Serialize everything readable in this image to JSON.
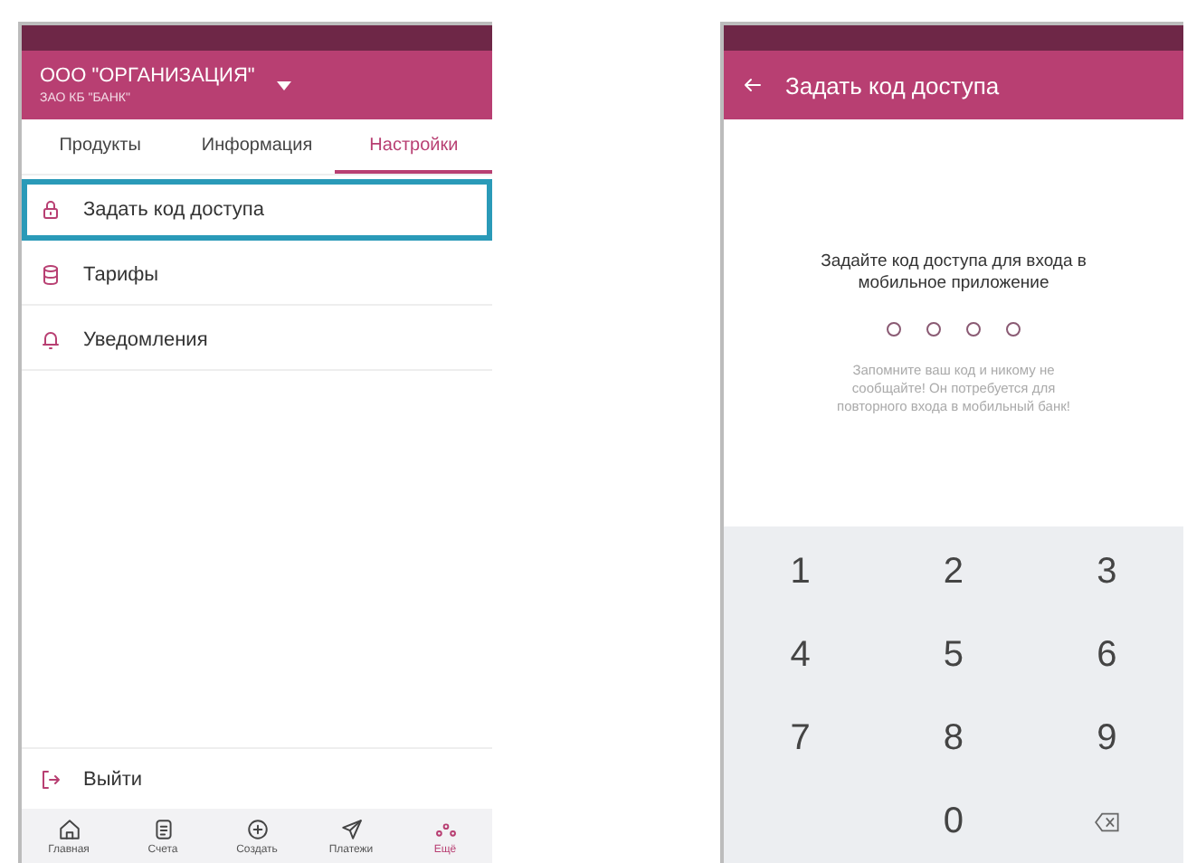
{
  "left_screen": {
    "header": {
      "organization": "ООО \"ОРГАНИЗАЦИЯ\"",
      "bank": "ЗАО КБ \"БАНК\""
    },
    "tabs": [
      {
        "label": "Продукты",
        "selected": false
      },
      {
        "label": "Информация",
        "selected": false
      },
      {
        "label": "Настройки",
        "selected": true
      }
    ],
    "menu": [
      {
        "label": "Задать код доступа",
        "kind": "lock",
        "highlighted": true
      },
      {
        "label": "Тарифы",
        "kind": "database",
        "highlighted": false
      },
      {
        "label": "Уведомления",
        "kind": "bell",
        "highlighted": false
      }
    ],
    "logout": {
      "label": "Выйти"
    },
    "bottom_nav": [
      {
        "label": "Главная",
        "kind": "home",
        "selected": false
      },
      {
        "label": "Счета",
        "kind": "document",
        "selected": false
      },
      {
        "label": "Создать",
        "kind": "plus",
        "selected": false
      },
      {
        "label": "Платежи",
        "kind": "send",
        "selected": false
      },
      {
        "label": "Ещё",
        "kind": "more",
        "selected": true
      }
    ]
  },
  "right_screen": {
    "title": "Задать код доступа",
    "prompt": "Задайте код доступа для входа в мобильное приложение",
    "pin_dots": [
      {
        "filled": false
      },
      {
        "filled": false
      },
      {
        "filled": false
      },
      {
        "filled": false
      }
    ],
    "hint": "Запомните ваш код и никому не сообщайте! Он потребуется для повторного входа в мобильный банк!",
    "keypad": [
      {
        "kind": "digit",
        "label": "1"
      },
      {
        "kind": "digit",
        "label": "2"
      },
      {
        "kind": "digit",
        "label": "3"
      },
      {
        "kind": "digit",
        "label": "4"
      },
      {
        "kind": "digit",
        "label": "5"
      },
      {
        "kind": "digit",
        "label": "6"
      },
      {
        "kind": "digit",
        "label": "7"
      },
      {
        "kind": "digit",
        "label": "8"
      },
      {
        "kind": "digit",
        "label": "9"
      },
      {
        "kind": "empty"
      },
      {
        "kind": "digit",
        "label": "0"
      },
      {
        "kind": "backspace"
      }
    ]
  }
}
